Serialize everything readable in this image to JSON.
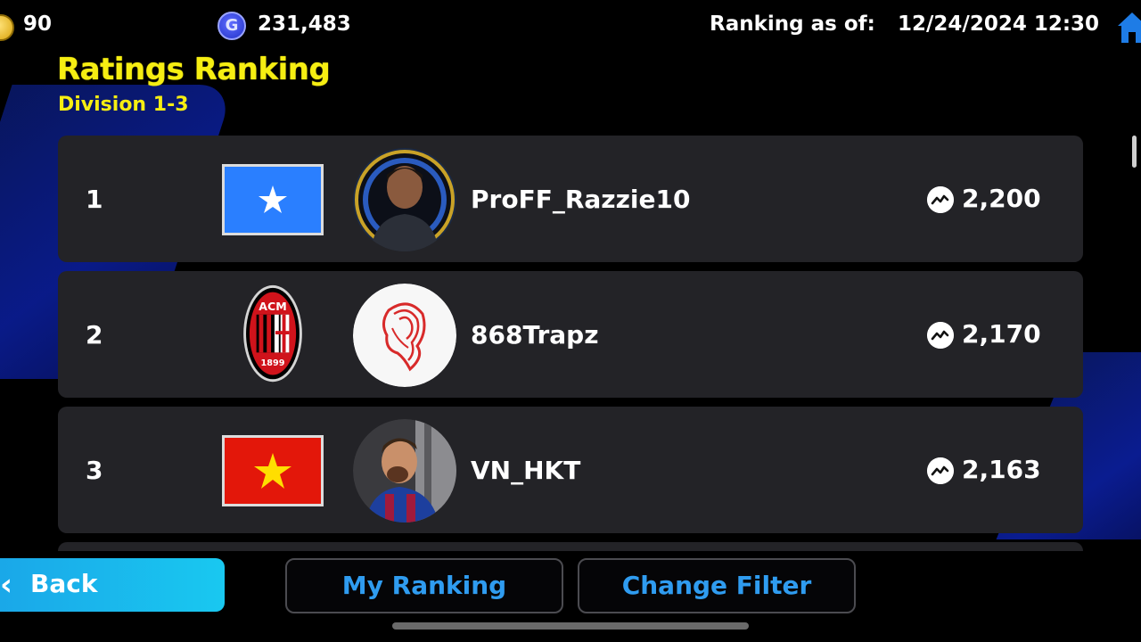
{
  "topbar": {
    "coins": "90",
    "gp": "231,483",
    "gp_icon_letter": "G",
    "ranking_label": "Ranking as of:",
    "ranking_date": "12/24/2024 12:30"
  },
  "header": {
    "title": "Ratings Ranking",
    "subtitle": "Division 1-3"
  },
  "rows": [
    {
      "rank": "1",
      "badge": "flag-somalia-icon",
      "name": "ProFF_Razzie10",
      "rating": "2,200"
    },
    {
      "rank": "2",
      "badge": "ac-milan-crest-icon",
      "name": "868Trapz",
      "rating": "2,170"
    },
    {
      "rank": "3",
      "badge": "flag-vietnam-icon",
      "name": "VN_HKT",
      "rating": "2,163"
    }
  ],
  "badge_texts": {
    "milan_top": "ACM",
    "milan_year": "1899"
  },
  "buttons": {
    "back": "Back",
    "my_ranking": "My Ranking",
    "change_filter": "Change Filter"
  },
  "colors": {
    "title_yellow": "#f6ee12",
    "button_blue": "#2f9cf0",
    "row_bg": "#232327"
  }
}
